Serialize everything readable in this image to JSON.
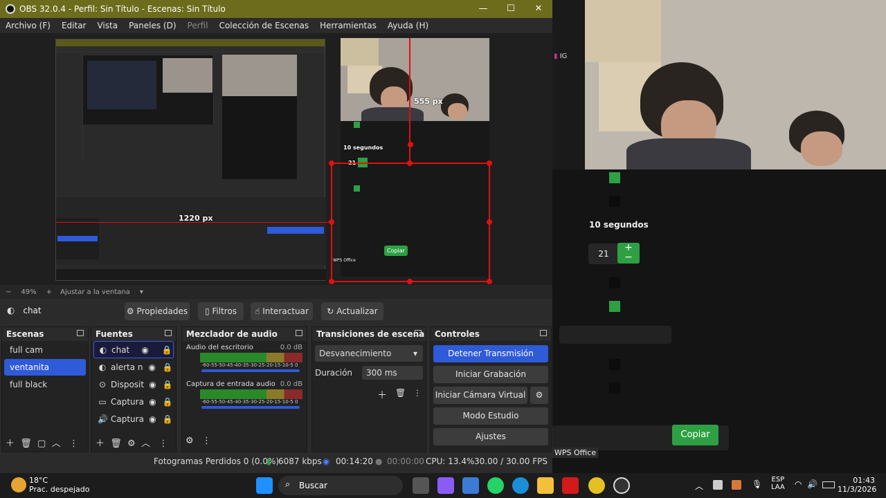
{
  "window": {
    "title": "OBS 32.0.4 - Perfil: Sin Título - Escenas: Sin Título",
    "min": "—",
    "max": "☐",
    "close": "✕"
  },
  "menu": {
    "archivo": "Archivo (F)",
    "editar": "Editar",
    "vista": "Vista",
    "paneles": "Paneles (D)",
    "perfil": "Perfil",
    "coleccion": "Colección de Escenas",
    "herramientas": "Herramientas",
    "ayuda": "Ayuda (H)"
  },
  "preview": {
    "label_555": "555 px",
    "label_1220": "1220 px",
    "segundos": "10 segundos",
    "num": "21",
    "copiar": "Copiar",
    "wps": "WPS Office"
  },
  "zoom": {
    "minus": "−",
    "value": "49%",
    "plus": "+",
    "fit": "Ajustar a la ventana"
  },
  "sourcebar": {
    "name": "chat",
    "propiedades": "Propiedades",
    "filtros": "Filtros",
    "interactuar": "Interactuar",
    "actualizar": "Actualizar"
  },
  "scenes": {
    "title": "Escenas",
    "items": [
      "full cam",
      "ventanita",
      "full black"
    ]
  },
  "sources": {
    "title": "Fuentes",
    "items": [
      {
        "icon": "◐",
        "label": "chat"
      },
      {
        "icon": "◐",
        "label": "alerta n"
      },
      {
        "icon": "⊙",
        "label": "Disposit"
      },
      {
        "icon": "▭",
        "label": "Captura"
      },
      {
        "icon": "🔊",
        "label": "Captura"
      }
    ]
  },
  "mixer": {
    "title": "Mezclador de audio",
    "ch1": {
      "name": "Audio del escritorio",
      "db": "0.0 dB"
    },
    "ch2": {
      "name": "Captura de entrada audio",
      "db": "0.0 dB"
    },
    "scale": "-60-55-50-45-40-35-30-25-20-15-10-5 0"
  },
  "transitions": {
    "title": "Transiciones de escena",
    "select": "Desvanecimiento",
    "duracion_label": "Duración",
    "duracion_value": "300 ms"
  },
  "controls": {
    "title": "Controles",
    "b1": "Detener Transmisión",
    "b2": "Iniciar Grabación",
    "b3": "Iniciar Cámara Virtual",
    "b4": "Modo Estudio",
    "b5": "Ajustes"
  },
  "status": {
    "frames": "Fotogramas Perdidos 0 (0.0%)",
    "kbps": "6087 kbps",
    "live": "00:14:20",
    "rec": "00:00:00",
    "cpu": "CPU: 13.4%",
    "fps": "30.00 / 30.00 FPS"
  },
  "right": {
    "ig": "IG",
    "segundos": "10 segundos",
    "num": "21",
    "copiar": "Copiar",
    "wps": "WPS Office"
  },
  "taskbar": {
    "temp": "18°C",
    "weather": "Prac. despejado",
    "search": "Buscar",
    "lang1": "ESP",
    "lang2": "LAA",
    "time": "01:43",
    "date": "11/3/2026"
  }
}
